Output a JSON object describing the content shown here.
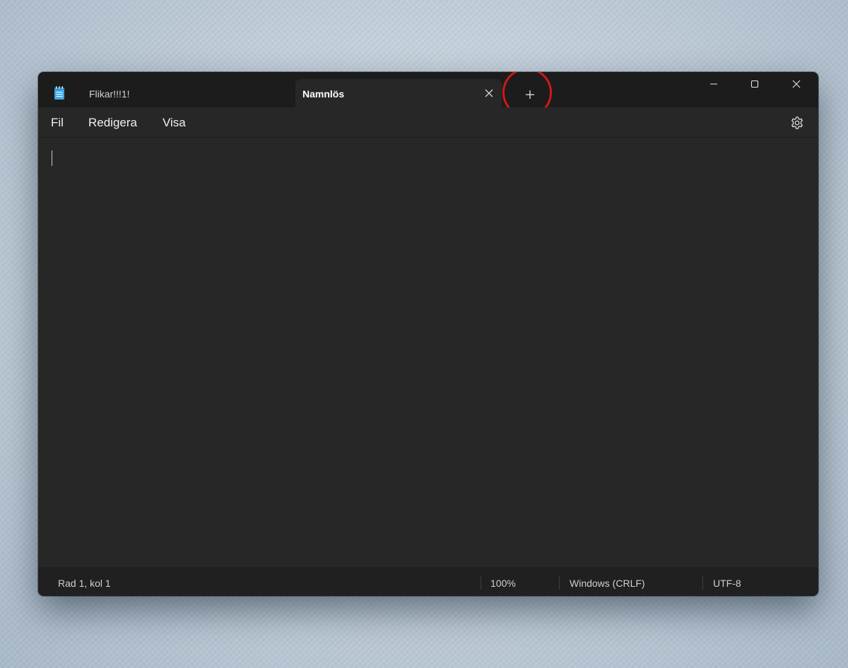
{
  "titlebar": {
    "app_icon": "notepad-icon",
    "tabs": [
      {
        "label": "Flikar!!!1!",
        "modified": true,
        "active": false
      },
      {
        "label": "Namnlös",
        "modified": false,
        "active": true
      }
    ],
    "new_tab_icon": "plus-icon",
    "window_controls": [
      "minimize-icon",
      "maximize-icon",
      "close-icon"
    ]
  },
  "menu": {
    "items": [
      "Fil",
      "Redigera",
      "Visa"
    ],
    "settings_icon": "gear-icon"
  },
  "editor": {
    "content": ""
  },
  "statusbar": {
    "position": "Rad 1, kol 1",
    "zoom": "100%",
    "line_ending": "Windows (CRLF)",
    "encoding": "UTF-8"
  },
  "colors": {
    "titlebar_bg": "#1c1c1c",
    "editor_bg": "#272727",
    "statusbar_bg": "#202020",
    "highlight": "#d01818",
    "accent_icon": "#3ba7e6"
  }
}
